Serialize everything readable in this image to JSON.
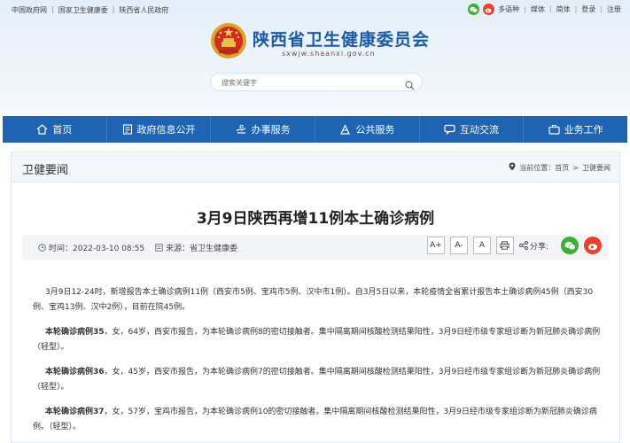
{
  "top_links": [
    "中国政府网",
    "国家卫生健康委",
    "陕西省人民政府"
  ],
  "top_right": {
    "items": [
      "多语种",
      "媒体",
      "简体",
      "登录",
      "注册"
    ]
  },
  "site": {
    "title": "陕西省卫生健康委员会",
    "url": "sxwjw.shaanxi.gov.cn"
  },
  "search": {
    "placeholder": "搜索关键字"
  },
  "nav": [
    {
      "label": "首页",
      "icon": "home-icon"
    },
    {
      "label": "政府信息公开",
      "icon": "info-icon"
    },
    {
      "label": "办事服务",
      "icon": "service-icon"
    },
    {
      "label": "公共服务",
      "icon": "public-icon"
    },
    {
      "label": "互动交流",
      "icon": "chat-icon"
    },
    {
      "label": "业务工作",
      "icon": "briefcase-icon"
    }
  ],
  "section": {
    "title": "卫健要闻",
    "breadcrumb": [
      "当前位置：",
      "首页",
      "卫健要闻"
    ]
  },
  "article": {
    "title": "3月9日陕西再增11例本土确诊病例",
    "time": "时间：2022-03-10 08:55",
    "source": "来源：省卫生健康委",
    "font_buttons": [
      "A+",
      "A-",
      "A"
    ],
    "share_label": "分享:",
    "p1": "3月9日12-24时，新增报告本土确诊病例11例（西安市5例、宝鸡市5例、汉中市1例）。自3月5日以来，本轮疫情全省累计报告本土确诊病例45例（西安30例、宝鸡13例、汉中2例），目前在院45例。",
    "p2_bold": "本轮确诊病例35",
    "p2": "，女，64岁，西安市报告，为本轮确诊病例8的密切接触者。集中隔离期间核酸检测结果阳性，3月9日经市级专家组诊断为新冠肺炎确诊病例（轻型）。",
    "p3_bold": "本轮确诊病例36",
    "p3": "，女，45岁，西安市报告，为本轮确诊病例7的密切接触者。集中隔离期间核酸检测结果阳性，3月9日经市级专家组诊断为新冠肺炎确诊病例（轻型）。",
    "p4_bold": "本轮确诊病例37",
    "p4": "，女，57岁，宝鸡市报告，为本轮确诊病例10的密切接触者。集中隔离期间核酸检测结果阳性，3月9日经市级专家组诊断为新冠肺炎确诊病例。（轻型）。"
  },
  "colors": {
    "nav_bg": "#1f64b3",
    "title_blue": "#1c5aa8"
  }
}
